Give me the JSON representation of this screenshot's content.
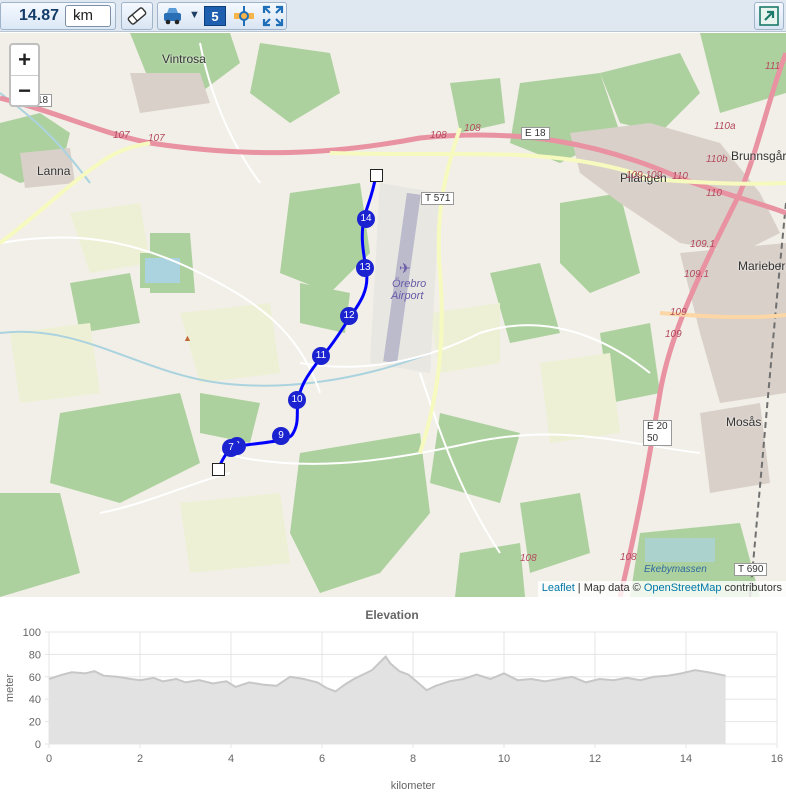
{
  "toolbar": {
    "distance": "14.87",
    "unit": "km",
    "waypoint_count": "5"
  },
  "map": {
    "zoom_in": "+",
    "zoom_out": "−",
    "labels": {
      "vintrosa": "Vintrosa",
      "lanna": "Lanna",
      "pilangen": "Pilängen",
      "brunnsgard": "Brunnsgår",
      "marieberg": "Marieberg",
      "mosas": "Mosås",
      "airport1": "Örebro",
      "airport2": "Airport",
      "ekeby": "Ekebymassen"
    },
    "shields": {
      "e18": "E 18",
      "e18left": "18",
      "t571": "T 571",
      "e20": "E 20",
      "e20b": "50",
      "t690": "T 690",
      "r111": "111",
      "r110a": "110a",
      "r110b": "110b"
    },
    "road_numbers": {
      "r107a": "107",
      "r107b": "107",
      "r108a": "108",
      "r108b": "108",
      "r108c": "108",
      "r109a": "109 109",
      "r110": "110",
      "r110c": "110",
      "r1091a": "109.1",
      "r1091b": "109.1",
      "r109b": "109",
      "r109c": "109",
      "r108d": "108"
    },
    "markers": [
      "14",
      "13",
      "12",
      "11",
      "10",
      "9",
      "8",
      "7"
    ],
    "attribution": {
      "leaflet": "Leaflet",
      "sep": " | Map data © ",
      "osm": "OpenStreetMap",
      "contrib": " contributors"
    }
  },
  "elevation": {
    "title": "Elevation",
    "ylabel": "meter",
    "xlabel": "kilometer"
  },
  "chart_data": {
    "type": "area",
    "title": "Elevation",
    "xlabel": "kilometer",
    "ylabel": "meter",
    "xlim": [
      0,
      16
    ],
    "ylim": [
      0,
      100
    ],
    "xticks": [
      0,
      2,
      4,
      6,
      8,
      10,
      12,
      14,
      16
    ],
    "yticks": [
      0,
      20,
      40,
      60,
      80,
      100
    ],
    "grid": true,
    "fill_color": "#e2e2e2",
    "line_color": "#c7c7c7",
    "x": [
      0,
      0.3,
      0.5,
      0.8,
      1.0,
      1.2,
      1.5,
      1.8,
      2.0,
      2.3,
      2.5,
      2.8,
      3.0,
      3.3,
      3.6,
      3.9,
      4.1,
      4.4,
      4.7,
      5.0,
      5.3,
      5.6,
      5.9,
      6.1,
      6.3,
      6.5,
      6.7,
      6.9,
      7.1,
      7.3,
      7.4,
      7.5,
      7.7,
      7.9,
      8.1,
      8.3,
      8.5,
      8.8,
      9.1,
      9.4,
      9.7,
      10.0,
      10.3,
      10.6,
      10.9,
      11.2,
      11.5,
      11.8,
      12.1,
      12.4,
      12.7,
      13.0,
      13.3,
      13.6,
      13.9,
      14.2,
      14.5,
      14.87
    ],
    "y": [
      58,
      62,
      64,
      63,
      65,
      61,
      60,
      58,
      57,
      59,
      56,
      58,
      55,
      57,
      54,
      56,
      51,
      55,
      53,
      52,
      60,
      58,
      55,
      50,
      47,
      53,
      58,
      62,
      66,
      74,
      78,
      72,
      65,
      62,
      55,
      48,
      52,
      56,
      58,
      62,
      58,
      63,
      57,
      58,
      56,
      58,
      60,
      55,
      58,
      57,
      59,
      57,
      60,
      61,
      63,
      66,
      64,
      61
    ]
  }
}
